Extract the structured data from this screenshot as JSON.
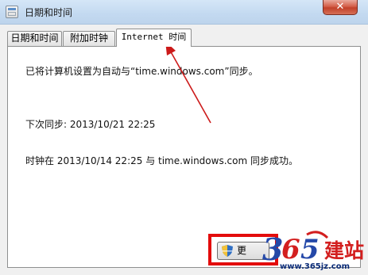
{
  "window": {
    "title": "日期和时间",
    "close_glyph": "✕"
  },
  "tabs": [
    {
      "label": "日期和时间",
      "active": false
    },
    {
      "label": "附加时钟",
      "active": false
    },
    {
      "label": "Internet 时间",
      "active": true
    }
  ],
  "content": {
    "line1": "已将计算机设置为自动与“time.windows.com”同步。",
    "line2": "下次同步: 2013/10/21 22:25",
    "line3": "时钟在 2013/10/14 22:25 与 time.windows.com 同步成功。"
  },
  "change_button": {
    "label": "更",
    "icon": "uac-shield-icon"
  },
  "annotation": {
    "arrow_color": "#cc1a1a",
    "box_color": "#e30c0c"
  },
  "watermark": {
    "logo_text": "365建站",
    "url": "www.365jz.com"
  }
}
